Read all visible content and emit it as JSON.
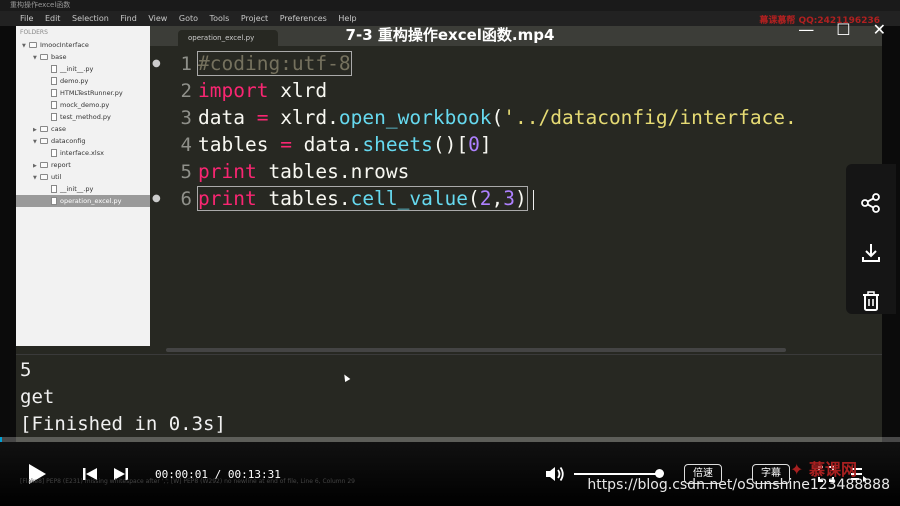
{
  "window": {
    "title": "重构操作excel函数",
    "menu": [
      "File",
      "Edit",
      "Selection",
      "Find",
      "View",
      "Goto",
      "Tools",
      "Project",
      "Preferences",
      "Help"
    ],
    "watermark": "幕课慕帮 QQ:2421196236"
  },
  "video": {
    "title": "7-3 重构操作excel函数.mp4",
    "time_current": "00:00:01",
    "time_total": "00:13:31",
    "progress": 0.002,
    "speed_label": "倍速",
    "subtitle_label": "字幕",
    "volume": 1.0
  },
  "sidebar": {
    "header": "FOLDERS",
    "items": [
      {
        "label": "ImoocInterface",
        "type": "folder",
        "depth": 0,
        "open": true
      },
      {
        "label": "base",
        "type": "folder",
        "depth": 1,
        "open": true
      },
      {
        "label": "__init__.py",
        "type": "file",
        "depth": 2
      },
      {
        "label": "demo.py",
        "type": "file",
        "depth": 2
      },
      {
        "label": "HTMLTestRunner.py",
        "type": "file",
        "depth": 2
      },
      {
        "label": "mock_demo.py",
        "type": "file",
        "depth": 2
      },
      {
        "label": "test_method.py",
        "type": "file",
        "depth": 2
      },
      {
        "label": "case",
        "type": "folder",
        "depth": 1,
        "open": false
      },
      {
        "label": "dataconfig",
        "type": "folder",
        "depth": 1,
        "open": true
      },
      {
        "label": "interface.xlsx",
        "type": "file",
        "depth": 2
      },
      {
        "label": "report",
        "type": "folder",
        "depth": 1,
        "open": false
      },
      {
        "label": "util",
        "type": "folder",
        "depth": 1,
        "open": true
      },
      {
        "label": "__init__.py",
        "type": "file",
        "depth": 2
      },
      {
        "label": "operation_excel.py",
        "type": "file",
        "depth": 2,
        "selected": true
      }
    ]
  },
  "editor": {
    "tab": "operation_excel.py",
    "line_numbers": [
      "1",
      "2",
      "3",
      "4",
      "5",
      "6"
    ],
    "lines": [
      [
        {
          "t": "#coding:utf-8",
          "c": "c"
        }
      ],
      [
        {
          "t": "import",
          "c": "k"
        },
        {
          "t": " xlrd",
          "c": ""
        }
      ],
      [
        {
          "t": "data ",
          "c": ""
        },
        {
          "t": "=",
          "c": "k"
        },
        {
          "t": " xlrd.",
          "c": ""
        },
        {
          "t": "open_workbook",
          "c": "f"
        },
        {
          "t": "(",
          "c": ""
        },
        {
          "t": "'../dataconfig/interface.",
          "c": "s"
        }
      ],
      [
        {
          "t": "tables ",
          "c": ""
        },
        {
          "t": "=",
          "c": "k"
        },
        {
          "t": " data.",
          "c": ""
        },
        {
          "t": "sheets",
          "c": "f"
        },
        {
          "t": "()[",
          "c": ""
        },
        {
          "t": "0",
          "c": "n"
        },
        {
          "t": "]",
          "c": ""
        }
      ],
      [
        {
          "t": "print",
          "c": "k"
        },
        {
          "t": " tables.nrows",
          "c": ""
        }
      ],
      [
        {
          "t": "print",
          "c": "k"
        },
        {
          "t": " tables.",
          "c": ""
        },
        {
          "t": "cell_value",
          "c": "f"
        },
        {
          "t": "(",
          "c": ""
        },
        {
          "t": "2",
          "c": "n"
        },
        {
          "t": ",",
          "c": ""
        },
        {
          "t": "3",
          "c": "n"
        },
        {
          "t": ")",
          "c": ""
        }
      ]
    ]
  },
  "console": {
    "lines": [
      "5",
      "get",
      "[Finished in 0.3s]"
    ]
  },
  "statusbar": "[Flake8] PEP8 (E231) missing whitespace after ','; [W] PEP8 (W292) no newline at end of file, Line 6, Column 29",
  "credit": "https://blog.csdn.net/oSunshine123488888",
  "icons": {
    "share": "share-icon",
    "download": "download-icon",
    "delete": "trash-icon"
  }
}
